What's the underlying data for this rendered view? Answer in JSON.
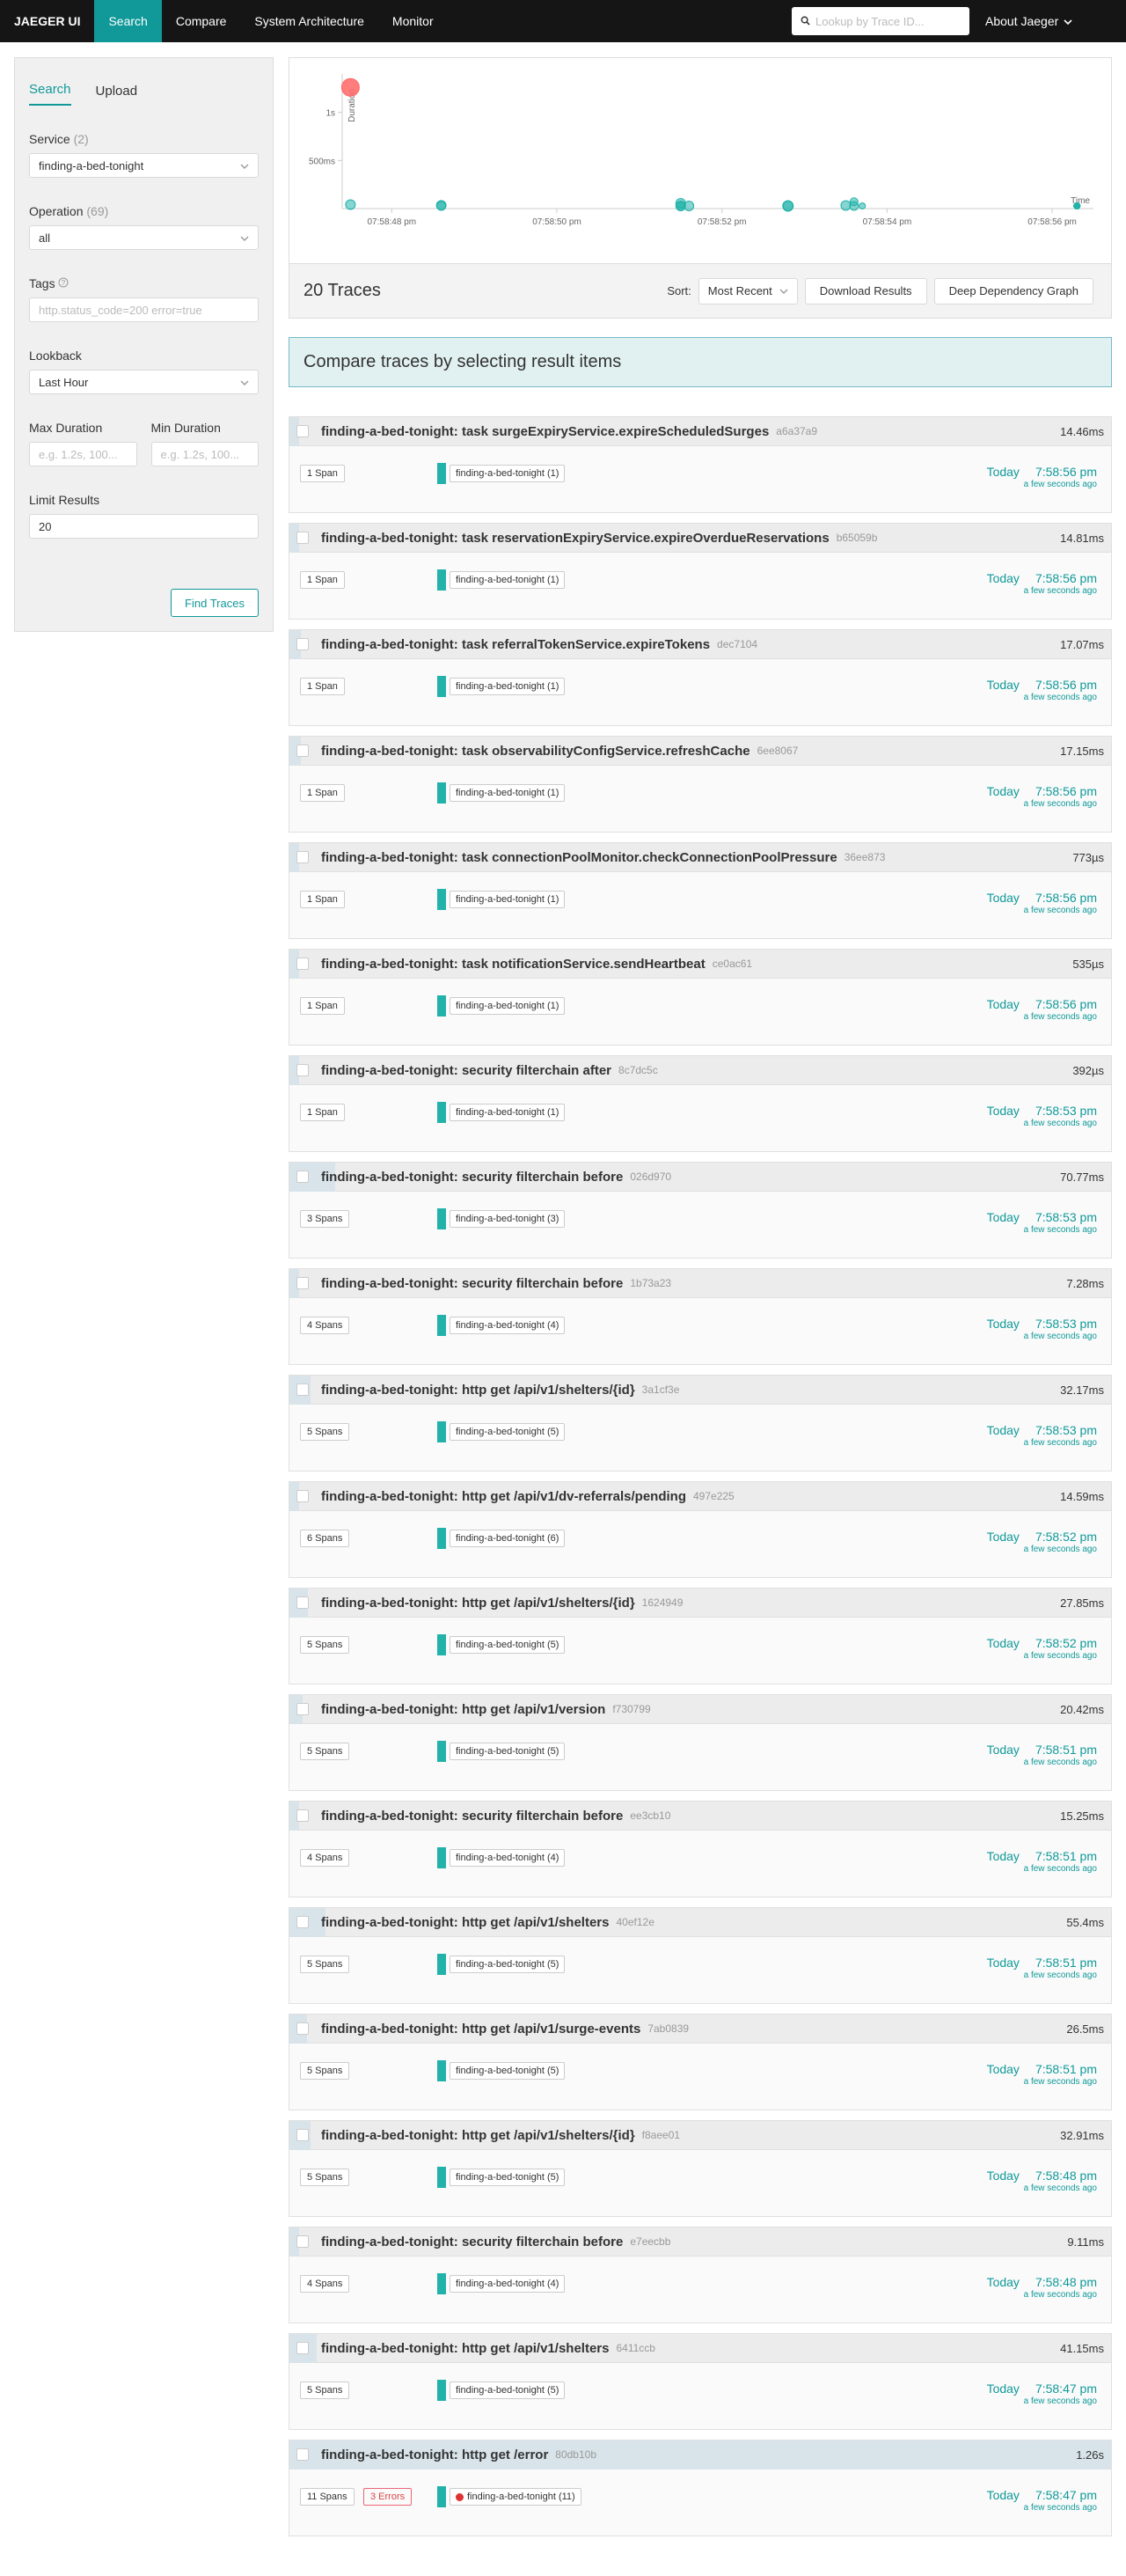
{
  "nav": {
    "brand": "JAEGER UI",
    "items": [
      "Search",
      "Compare",
      "System Architecture",
      "Monitor"
    ],
    "search_placeholder": "Lookup by Trace ID...",
    "about": "About Jaeger"
  },
  "search_form": {
    "tabs": [
      "Search",
      "Upload"
    ],
    "service_label": "Service",
    "service_count": "(2)",
    "service_value": "finding-a-bed-tonight",
    "operation_label": "Operation",
    "operation_count": "(69)",
    "operation_value": "all",
    "tags_label": "Tags",
    "tags_placeholder": "http.status_code=200 error=true",
    "lookback_label": "Lookback",
    "lookback_value": "Last Hour",
    "max_duration_label": "Max Duration",
    "max_duration_placeholder": "e.g. 1.2s, 100...",
    "min_duration_label": "Min Duration",
    "min_duration_placeholder": "e.g. 1.2s, 100...",
    "limit_label": "Limit Results",
    "limit_value": "20",
    "find_button": "Find Traces"
  },
  "chart_data": {
    "type": "scatter",
    "ylabel": "Duration",
    "xlabel": "Time",
    "y_ticks": [
      "500ms",
      "1s"
    ],
    "x_ticks": [
      "07:58:48 pm",
      "07:58:50 pm",
      "07:58:52 pm",
      "07:58:54 pm",
      "07:58:56 pm"
    ],
    "xlim_seconds": [
      47.6,
      56.7
    ],
    "ylim_ms": [
      0,
      1400
    ],
    "points": [
      {
        "t": 47.7,
        "ms": 1260,
        "spans": 11,
        "error": true
      },
      {
        "t": 47.7,
        "ms": 41.15,
        "spans": 5
      },
      {
        "t": 48.8,
        "ms": 32.91,
        "spans": 5
      },
      {
        "t": 48.8,
        "ms": 9.11,
        "spans": 4
      },
      {
        "t": 51.7,
        "ms": 26.5,
        "spans": 5
      },
      {
        "t": 51.7,
        "ms": 55.4,
        "spans": 5
      },
      {
        "t": 51.7,
        "ms": 15.25,
        "spans": 4
      },
      {
        "t": 51.8,
        "ms": 20.42,
        "spans": 5
      },
      {
        "t": 53.0,
        "ms": 27.85,
        "spans": 5
      },
      {
        "t": 53.0,
        "ms": 14.59,
        "spans": 6
      },
      {
        "t": 53.7,
        "ms": 32.17,
        "spans": 5
      },
      {
        "t": 53.8,
        "ms": 7.28,
        "spans": 4
      },
      {
        "t": 53.8,
        "ms": 70.77,
        "spans": 3
      },
      {
        "t": 53.9,
        "ms": 0.392,
        "spans": 1
      },
      {
        "t": 56.5,
        "ms": 0.535,
        "spans": 1
      },
      {
        "t": 56.5,
        "ms": 0.773,
        "spans": 1
      },
      {
        "t": 56.5,
        "ms": 17.15,
        "spans": 1
      },
      {
        "t": 56.5,
        "ms": 17.07,
        "spans": 1
      },
      {
        "t": 56.5,
        "ms": 14.81,
        "spans": 1
      },
      {
        "t": 56.5,
        "ms": 14.46,
        "spans": 1
      }
    ],
    "colors": {
      "normal": "#22b2aa",
      "error": "#f66"
    }
  },
  "results": {
    "count_label": "20 Traces",
    "sort_label": "Sort:",
    "sort_value": "Most Recent",
    "download_button": "Download Results",
    "deep_button": "Deep Dependency Graph",
    "compare_banner": "Compare traces by selecting result items"
  },
  "traces": [
    {
      "name": "finding-a-bed-tonight: task surgeExpiryService.expireScheduledSurges",
      "id": "a6a37a9",
      "duration": "14.46ms",
      "dur_frac": 0.012,
      "spans": "1 Span",
      "service": "finding-a-bed-tonight (1)",
      "date": "Today",
      "time": "7:58:56 pm",
      "ago": "a few seconds ago",
      "errors": ""
    },
    {
      "name": "finding-a-bed-tonight: task reservationExpiryService.expireOverdueReservations",
      "id": "b65059b",
      "duration": "14.81ms",
      "dur_frac": 0.012,
      "spans": "1 Span",
      "service": "finding-a-bed-tonight (1)",
      "date": "Today",
      "time": "7:58:56 pm",
      "ago": "a few seconds ago",
      "errors": ""
    },
    {
      "name": "finding-a-bed-tonight: task referralTokenService.expireTokens",
      "id": "dec7104",
      "duration": "17.07ms",
      "dur_frac": 0.014,
      "spans": "1 Span",
      "service": "finding-a-bed-tonight (1)",
      "date": "Today",
      "time": "7:58:56 pm",
      "ago": "a few seconds ago",
      "errors": ""
    },
    {
      "name": "finding-a-bed-tonight: task observabilityConfigService.refreshCache",
      "id": "6ee8067",
      "duration": "17.15ms",
      "dur_frac": 0.014,
      "spans": "1 Span",
      "service": "finding-a-bed-tonight (1)",
      "date": "Today",
      "time": "7:58:56 pm",
      "ago": "a few seconds ago",
      "errors": ""
    },
    {
      "name": "finding-a-bed-tonight: task connectionPoolMonitor.checkConnectionPoolPressure",
      "id": "36ee873",
      "duration": "773µs",
      "dur_frac": 0.001,
      "spans": "1 Span",
      "service": "finding-a-bed-tonight (1)",
      "date": "Today",
      "time": "7:58:56 pm",
      "ago": "a few seconds ago",
      "errors": ""
    },
    {
      "name": "finding-a-bed-tonight: task notificationService.sendHeartbeat",
      "id": "ce0ac61",
      "duration": "535µs",
      "dur_frac": 0.001,
      "spans": "1 Span",
      "service": "finding-a-bed-tonight (1)",
      "date": "Today",
      "time": "7:58:56 pm",
      "ago": "a few seconds ago",
      "errors": ""
    },
    {
      "name": "finding-a-bed-tonight: security filterchain after",
      "id": "8c7dc5c",
      "duration": "392µs",
      "dur_frac": 0.001,
      "spans": "1 Span",
      "service": "finding-a-bed-tonight (1)",
      "date": "Today",
      "time": "7:58:53 pm",
      "ago": "a few seconds ago",
      "errors": ""
    },
    {
      "name": "finding-a-bed-tonight: security filterchain before",
      "id": "026d970",
      "duration": "70.77ms",
      "dur_frac": 0.056,
      "spans": "3 Spans",
      "service": "finding-a-bed-tonight (3)",
      "date": "Today",
      "time": "7:58:53 pm",
      "ago": "a few seconds ago",
      "errors": ""
    },
    {
      "name": "finding-a-bed-tonight: security filterchain before",
      "id": "1b73a23",
      "duration": "7.28ms",
      "dur_frac": 0.006,
      "spans": "4 Spans",
      "service": "finding-a-bed-tonight (4)",
      "date": "Today",
      "time": "7:58:53 pm",
      "ago": "a few seconds ago",
      "errors": ""
    },
    {
      "name": "finding-a-bed-tonight: http get /api/v1/shelters/{id}",
      "id": "3a1cf3e",
      "duration": "32.17ms",
      "dur_frac": 0.026,
      "spans": "5 Spans",
      "service": "finding-a-bed-tonight (5)",
      "date": "Today",
      "time": "7:58:53 pm",
      "ago": "a few seconds ago",
      "errors": ""
    },
    {
      "name": "finding-a-bed-tonight: http get /api/v1/dv-referrals/pending",
      "id": "497e225",
      "duration": "14.59ms",
      "dur_frac": 0.012,
      "spans": "6 Spans",
      "service": "finding-a-bed-tonight (6)",
      "date": "Today",
      "time": "7:58:52 pm",
      "ago": "a few seconds ago",
      "errors": ""
    },
    {
      "name": "finding-a-bed-tonight: http get /api/v1/shelters/{id}",
      "id": "1624949",
      "duration": "27.85ms",
      "dur_frac": 0.022,
      "spans": "5 Spans",
      "service": "finding-a-bed-tonight (5)",
      "date": "Today",
      "time": "7:58:52 pm",
      "ago": "a few seconds ago",
      "errors": ""
    },
    {
      "name": "finding-a-bed-tonight: http get /api/v1/version",
      "id": "f730799",
      "duration": "20.42ms",
      "dur_frac": 0.016,
      "spans": "5 Spans",
      "service": "finding-a-bed-tonight (5)",
      "date": "Today",
      "time": "7:58:51 pm",
      "ago": "a few seconds ago",
      "errors": ""
    },
    {
      "name": "finding-a-bed-tonight: security filterchain before",
      "id": "ee3cb10",
      "duration": "15.25ms",
      "dur_frac": 0.012,
      "spans": "4 Spans",
      "service": "finding-a-bed-tonight (4)",
      "date": "Today",
      "time": "7:58:51 pm",
      "ago": "a few seconds ago",
      "errors": ""
    },
    {
      "name": "finding-a-bed-tonight: http get /api/v1/shelters",
      "id": "40ef12e",
      "duration": "55.4ms",
      "dur_frac": 0.044,
      "spans": "5 Spans",
      "service": "finding-a-bed-tonight (5)",
      "date": "Today",
      "time": "7:58:51 pm",
      "ago": "a few seconds ago",
      "errors": ""
    },
    {
      "name": "finding-a-bed-tonight: http get /api/v1/surge-events",
      "id": "7ab0839",
      "duration": "26.5ms",
      "dur_frac": 0.021,
      "spans": "5 Spans",
      "service": "finding-a-bed-tonight (5)",
      "date": "Today",
      "time": "7:58:51 pm",
      "ago": "a few seconds ago",
      "errors": ""
    },
    {
      "name": "finding-a-bed-tonight: http get /api/v1/shelters/{id}",
      "id": "f8aee01",
      "duration": "32.91ms",
      "dur_frac": 0.026,
      "spans": "5 Spans",
      "service": "finding-a-bed-tonight (5)",
      "date": "Today",
      "time": "7:58:48 pm",
      "ago": "a few seconds ago",
      "errors": ""
    },
    {
      "name": "finding-a-bed-tonight: security filterchain before",
      "id": "e7eecbb",
      "duration": "9.11ms",
      "dur_frac": 0.007,
      "spans": "4 Spans",
      "service": "finding-a-bed-tonight (4)",
      "date": "Today",
      "time": "7:58:48 pm",
      "ago": "a few seconds ago",
      "errors": ""
    },
    {
      "name": "finding-a-bed-tonight: http get /api/v1/shelters",
      "id": "6411ccb",
      "duration": "41.15ms",
      "dur_frac": 0.033,
      "spans": "5 Spans",
      "service": "finding-a-bed-tonight (5)",
      "date": "Today",
      "time": "7:58:47 pm",
      "ago": "a few seconds ago",
      "errors": ""
    },
    {
      "name": "finding-a-bed-tonight: http get /error",
      "id": "80db10b",
      "duration": "1.26s",
      "dur_frac": 1.0,
      "spans": "11 Spans",
      "service": "finding-a-bed-tonight (11)",
      "date": "Today",
      "time": "7:58:47 pm",
      "ago": "a few seconds ago",
      "errors": "3 Errors"
    }
  ]
}
